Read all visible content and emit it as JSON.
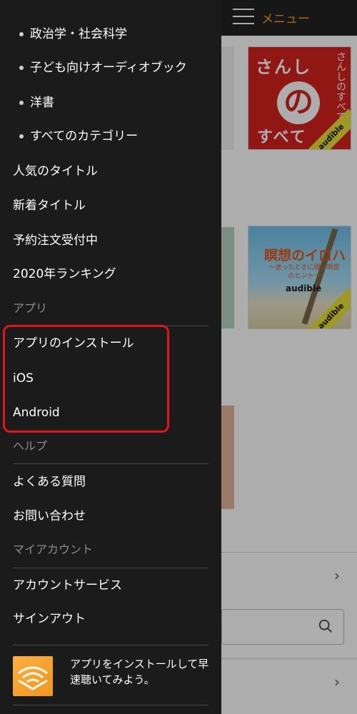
{
  "header": {
    "menu_label": "メニュー"
  },
  "covers": {
    "cover1": {
      "title_top": "さんし",
      "title_no": "の",
      "title_bottom": "すべて",
      "side_text": "さんしのすべて",
      "badge": "audible"
    },
    "cover2": {
      "title": "瞑想のイロハ",
      "subtitle": "～迷ったときに聞く瞑想のヒント～",
      "logo": "audible",
      "badge": "audible"
    }
  },
  "drawer": {
    "top_items": [
      {
        "label": "政治学・社会科学"
      },
      {
        "label": "子ども向けオーディオブック"
      },
      {
        "label": "洋書"
      },
      {
        "label": "すべてのカテゴリー"
      }
    ],
    "main_items": [
      {
        "label": "人気のタイトル"
      },
      {
        "label": "新着タイトル"
      },
      {
        "label": "予約注文受付中"
      },
      {
        "label": "2020年ランキング"
      }
    ],
    "sections": {
      "apps": "アプリ",
      "help": "ヘルプ",
      "account": "マイアカウント"
    },
    "app_items": [
      {
        "label": "アプリのインストール"
      },
      {
        "label": "iOS"
      },
      {
        "label": "Android"
      }
    ],
    "help_items": [
      {
        "label": "よくある質問"
      },
      {
        "label": "お問い合わせ"
      }
    ],
    "account_items": [
      {
        "label": "アカウントサービス"
      },
      {
        "label": "サインアウト"
      }
    ],
    "promo": {
      "text": "アプリをインストールして早速聴いてみよう。",
      "icon": "audible-app-icon"
    }
  },
  "colors": {
    "drawer_bg": "#1b1b1b",
    "accent": "#f7a21b",
    "highlight": "#e2141c",
    "section_text": "#8c8c8c"
  }
}
